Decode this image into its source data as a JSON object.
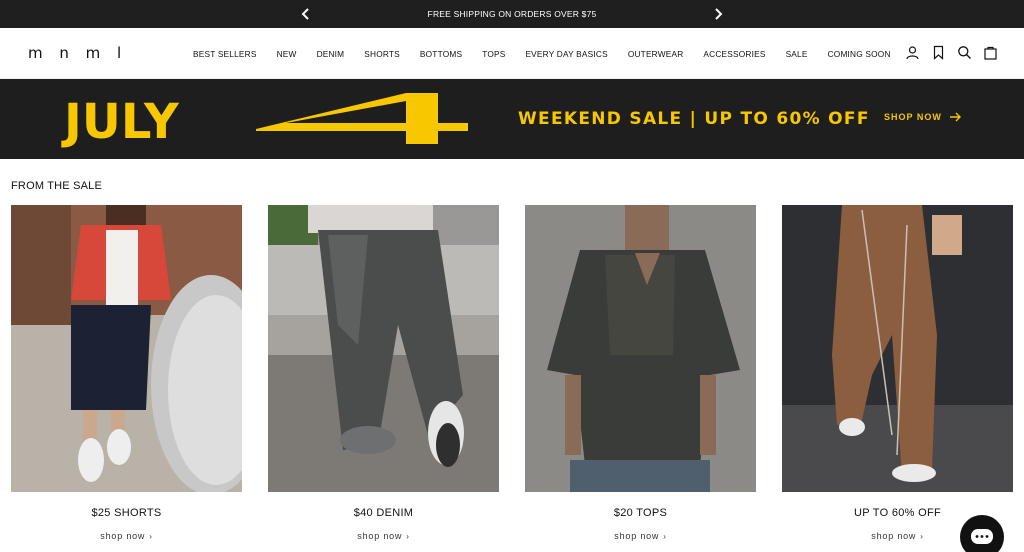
{
  "announcement": {
    "message": "FREE SHIPPING ON ORDERS OVER $75",
    "prev_icon": "chevron-left-icon",
    "next_icon": "chevron-right-icon"
  },
  "header": {
    "logo": "m n m l",
    "nav": [
      "BEST SELLERS",
      "NEW",
      "DENIM",
      "SHORTS",
      "BOTTOMS",
      "TOPS",
      "EVERY DAY BASICS",
      "OUTERWEAR",
      "ACCESSORIES",
      "SALE",
      "COMING SOON"
    ],
    "icons": [
      "account-icon",
      "wishlist-icon",
      "search-icon",
      "cart-icon"
    ]
  },
  "banner": {
    "headline": "JULY",
    "sale_text": "WEEKEND SALE | UP TO 60% OFF",
    "cta": "SHOP NOW",
    "accent_color": "#f7c700",
    "background_color": "#1e1e1e"
  },
  "section": {
    "title": "FROM THE SALE",
    "cards": [
      {
        "title": "$25 SHORTS",
        "link": "shop now"
      },
      {
        "title": "$40 DENIM",
        "link": "shop now"
      },
      {
        "title": "$20 TOPS",
        "link": "shop now"
      },
      {
        "title": "UP TO 60% OFF",
        "link": "shop now"
      }
    ]
  },
  "chat": {
    "icon": "chat-icon"
  }
}
